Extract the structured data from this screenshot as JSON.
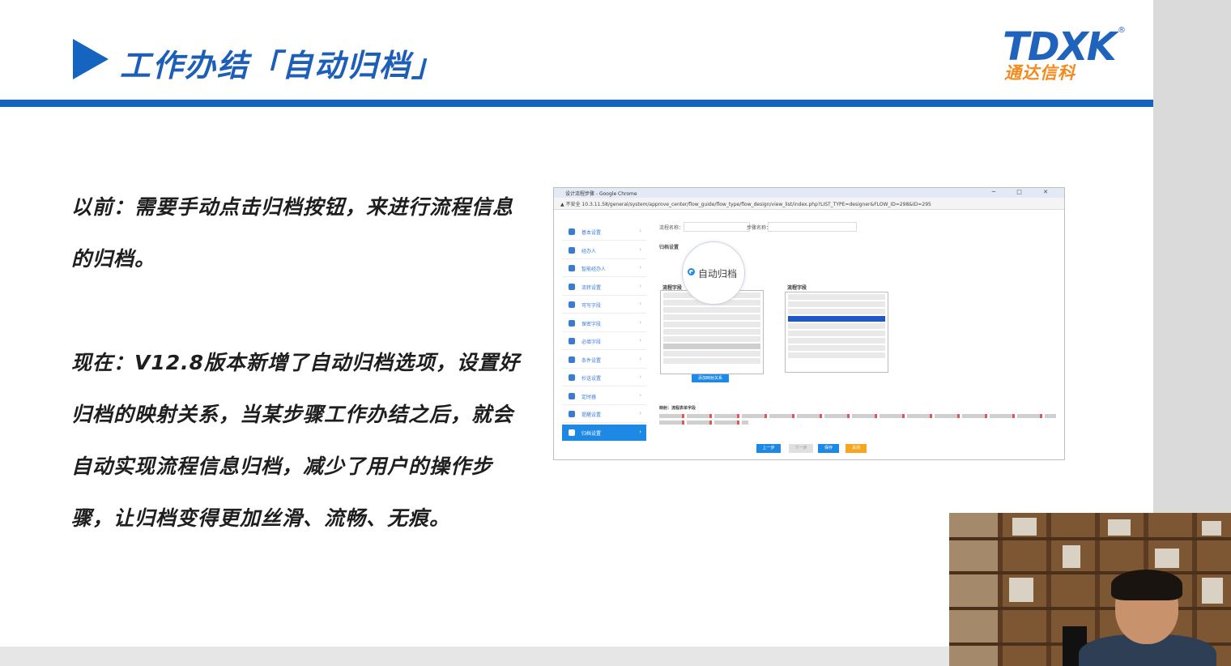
{
  "slide": {
    "title": "工作办结「自动归档」",
    "logo": {
      "main": "TDXK",
      "reg": "®",
      "sub": "通达信科"
    },
    "paragraph_before": "以前：需要手动点击归档按钮，来进行流程信息的归档。",
    "paragraph_now": "现在：V12.8版本新增了自动归档选项，设置好归档的映射关系，当某步骤工作办结之后，就会自动实现流程信息归档，减少了用户的操作步骤，让归档变得更加丝滑、流畅、无痕。",
    "colors": {
      "accent": "#1565c0",
      "logo_orange": "#f28a1e",
      "nav_active": "#1e88e5"
    }
  },
  "screenshot": {
    "window_title": "设计流程步骤 - Google Chrome",
    "address": "▲ 不安全  10.3.11.58/general/system/approve_center/flow_guide/flow_type/flow_design/view_list/index.php?LIST_TYPE=designer&FLOW_ID=298&ID=295",
    "window_controls": "─ □ ✕",
    "magnified_option": "自动归档",
    "nav_items": [
      "基本设置",
      "经办人",
      "智能经办人",
      "流转设置",
      "可写字段",
      "保密字段",
      "必填字段",
      "条件设置",
      "抄送设置",
      "定时器",
      "提醒设置",
      "归档设置"
    ],
    "section_archive": "归档设置",
    "left_list_header": "流程字段",
    "right_list_header": "流程字段",
    "mapping_header": "映射：流程表单字段",
    "add_button": "添加映射关系",
    "footer_buttons": [
      "上一步",
      "下一步",
      "保存",
      "关闭"
    ],
    "footer_colors": [
      "#1e88e5",
      "#e0e0e0",
      "#1e88e5",
      "#f5a623"
    ]
  }
}
